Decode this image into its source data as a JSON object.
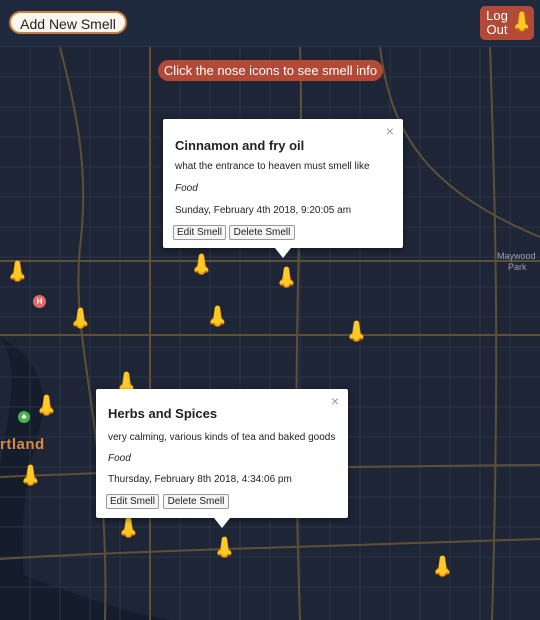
{
  "header": {
    "add_label": "Add New Smell",
    "logout_line1": "Log",
    "logout_line2": "Out",
    "logout_icon": "nose-icon"
  },
  "banner": {
    "text": "Click the nose icons to see smell info"
  },
  "map": {
    "city_label": "rtland",
    "place_label_1": "Maywood",
    "place_label_2": "Park",
    "hospital_glyph": "H",
    "park_glyph": "♣"
  },
  "nose_glyph": "👃",
  "popups": [
    {
      "title": "Cinnamon and fry oil",
      "description": "what the entrance to heaven must smell like",
      "category": "Food",
      "date": "Sunday, February 4th 2018, 9:20:05 am",
      "edit_label": "Edit Smell",
      "delete_label": "Delete Smell",
      "close": "×"
    },
    {
      "title": "Herbs and Spices",
      "description": "very calming, various kinds of tea and baked goods",
      "category": "Food",
      "date": "Thursday, February 8th 2018, 4:34:06 pm",
      "edit_label": "Edit Smell",
      "delete_label": "Delete Smell",
      "close": "×"
    }
  ],
  "colors": {
    "map_background": "#1d2536",
    "accent": "#b34937",
    "nose": "#f2c03a",
    "road": "#6b5a3e"
  }
}
